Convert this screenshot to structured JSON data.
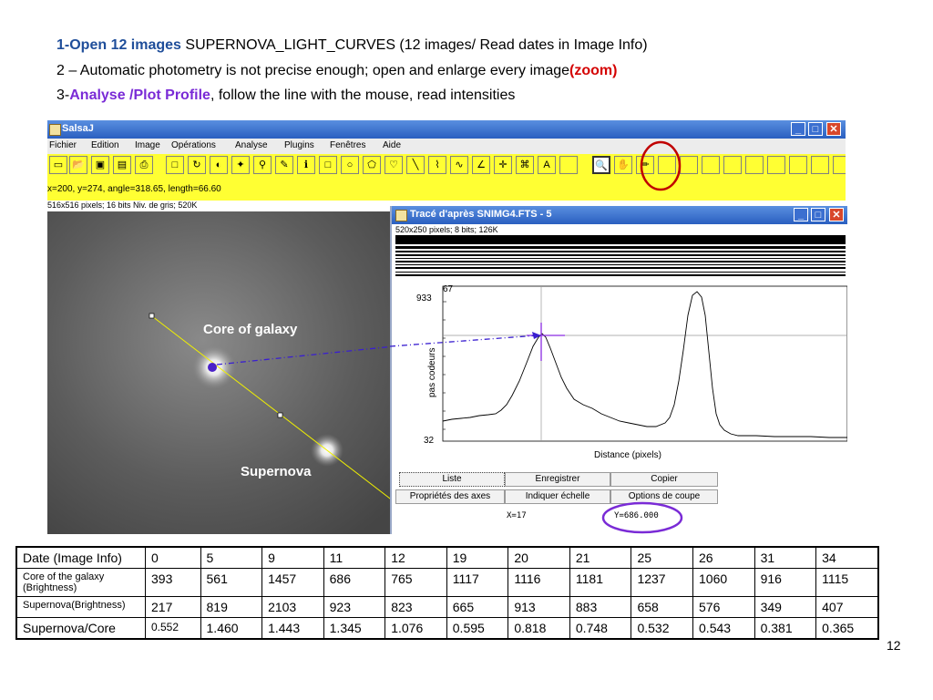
{
  "instructions": {
    "line1": {
      "bold": "1-Open 12 images",
      "rest": " SUPERNOVA_LIGHT_CURVES (12 images/ Read dates in Image Info)"
    },
    "line2": {
      "prefix": "2 – Automatic photometry is not precise enough; open and enlarge every image",
      "highlight": "(zoom)"
    },
    "line3": {
      "prefix": "3-",
      "highlight": "Analyse /Plot Profile",
      "rest": ",  follow the line with the mouse, read intensities"
    }
  },
  "salsa": {
    "title": "SalsaJ",
    "menu": [
      "Fichier",
      "Edition",
      "Image",
      "Opérations",
      "Analyse",
      "Plugins",
      "Fenêtres",
      "Aide"
    ],
    "tools": [
      {
        "name": "new-file-icon",
        "glyph": "▭"
      },
      {
        "name": "open-folder-icon",
        "glyph": "📂"
      },
      {
        "name": "save-icon",
        "glyph": "▣"
      },
      {
        "name": "save-all-icon",
        "glyph": "▤"
      },
      {
        "name": "print-icon",
        "glyph": "⎙"
      },
      {
        "name": "rectangle-select-icon",
        "glyph": "□"
      },
      {
        "name": "rotate-icon",
        "glyph": "↻"
      },
      {
        "name": "contrast-icon",
        "glyph": "◐"
      },
      {
        "name": "magic-wand-icon",
        "glyph": "✦"
      },
      {
        "name": "measure-icon",
        "glyph": "⚲"
      },
      {
        "name": "dropper-icon",
        "glyph": "✎"
      },
      {
        "name": "info-icon",
        "glyph": "ℹ"
      },
      {
        "name": "rectangle-tool-icon",
        "glyph": "□"
      },
      {
        "name": "oval-tool-icon",
        "glyph": "○"
      },
      {
        "name": "polygon-tool-icon",
        "glyph": "⬠"
      },
      {
        "name": "freehand-tool-icon",
        "glyph": "♡"
      },
      {
        "name": "line-tool-icon",
        "glyph": "╲"
      },
      {
        "name": "segmented-line-icon",
        "glyph": "⌇"
      },
      {
        "name": "freehand-line-icon",
        "glyph": "∿"
      },
      {
        "name": "angle-tool-icon",
        "glyph": "∠"
      },
      {
        "name": "crosshair-tool-icon",
        "glyph": "✛"
      },
      {
        "name": "wand-select-icon",
        "glyph": "⌘"
      },
      {
        "name": "text-tool-icon",
        "glyph": "A"
      },
      {
        "name": "blank-tool-icon",
        "glyph": ""
      },
      {
        "name": "zoom-tool-icon",
        "glyph": "🔍"
      },
      {
        "name": "hand-tool-icon",
        "glyph": "✋"
      },
      {
        "name": "pencil-tool-icon",
        "glyph": "✏"
      }
    ],
    "status": "x=200, y=274, angle=318.65, length=66.60",
    "image_info": "516x516 pixels; 16 bits Niv. de gris; 520K",
    "labels": {
      "core": "Core of galaxy",
      "supernova": "Supernova"
    }
  },
  "profile": {
    "title": "Tracé d'après SNIMG4.FTS - 5",
    "info": "520x250 pixels; 8 bits; 126K",
    "y_top_label": "933",
    "y_bottom_label": "32",
    "corner_label": "67",
    "ylabel": "pas codeurs",
    "xlabel": "Distance (pixels)",
    "buttons": [
      [
        "Liste",
        "Enregistrer",
        "Copier"
      ],
      [
        "Propriétés des axes",
        "Indiquer échelle",
        "Options de coupe"
      ]
    ],
    "x_readout": "X=17",
    "y_readout": "Y=686.000"
  },
  "table": {
    "rows": [
      {
        "label": "Date (Image Info)",
        "values": [
          "0",
          "5",
          "9",
          "11",
          "12",
          "19",
          "20",
          "21",
          "25",
          "26",
          "31",
          "34"
        ]
      },
      {
        "label": "Core of the galaxy (Brightness)",
        "values": [
          "393",
          "561",
          "1457",
          "686",
          "765",
          "1117",
          "1116",
          "1181",
          "1237",
          "1060",
          "916",
          "1115"
        ]
      },
      {
        "label": "Supernova(Brightness)",
        "values": [
          "217",
          "819",
          "2103",
          "923",
          "823",
          "665",
          "913",
          "883",
          "658",
          "576",
          "349",
          "407"
        ]
      },
      {
        "label": "Supernova/Core",
        "values": [
          "0.552",
          "1.460",
          "1.443",
          "1.345",
          "1.076",
          "0.595",
          "0.818",
          "0.748",
          "0.532",
          "0.543",
          "0.381",
          "0.365"
        ]
      }
    ]
  },
  "page_number": "12",
  "colors": {
    "toolbar": "#ffff33",
    "annotation_red": "#c00000",
    "annotation_purple": "#7a2bd6",
    "heading_blue": "#1f4e9a"
  }
}
